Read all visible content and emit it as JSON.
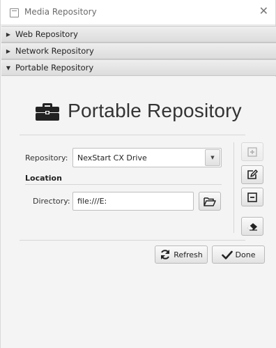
{
  "window": {
    "title": "Media Repository",
    "app_icon": "window-icon",
    "close_glyph": "✕"
  },
  "accordion": [
    {
      "label": "Web Repository",
      "expanded": false
    },
    {
      "label": "Network Repository",
      "expanded": false
    },
    {
      "label": "Portable Repository",
      "expanded": true
    }
  ],
  "arrows": {
    "collapsed": "▶",
    "expanded": "▼"
  },
  "panel": {
    "heading": "Portable Repository",
    "heading_icon": "briefcase-icon",
    "repository_label": "Repository:",
    "repository_value": "NexStart CX Drive",
    "dropdown_glyph": "▼",
    "location_title": "Location",
    "directory_label": "Directory:",
    "directory_value": "file:///E:",
    "side_buttons": [
      {
        "icon": "add-icon",
        "enabled": false
      },
      {
        "icon": "edit-icon",
        "enabled": true
      },
      {
        "icon": "remove-icon",
        "enabled": true
      },
      {
        "icon": "eraser-icon",
        "enabled": true
      }
    ],
    "refresh_label": "Refresh",
    "done_label": "Done"
  }
}
